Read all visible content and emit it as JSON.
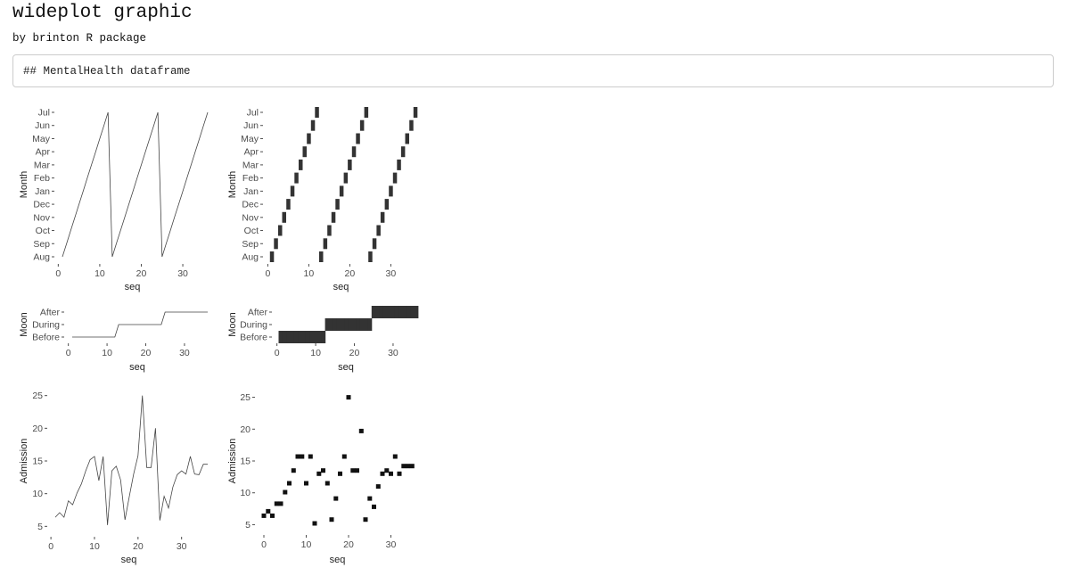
{
  "page": {
    "title": "wideplot graphic",
    "subtitle": "by brinton R package",
    "code_text": "## MentalHealth dataframe"
  },
  "colors": {
    "line": "#444444",
    "ribbon": "#333333",
    "point": "#111111",
    "tick": "#4d4d4d",
    "text": "#222222"
  },
  "chart_data": [
    {
      "id": "month-line",
      "type": "line",
      "xlabel": "seq",
      "ylabel": "Month",
      "xticks": [
        0,
        10,
        20,
        30
      ],
      "xlim": [
        1,
        36
      ],
      "y_categories": [
        "Aug",
        "Sep",
        "Oct",
        "Nov",
        "Dec",
        "Jan",
        "Feb",
        "Mar",
        "Apr",
        "May",
        "Jun",
        "Jul"
      ],
      "x": [
        1,
        2,
        3,
        4,
        5,
        6,
        7,
        8,
        9,
        10,
        11,
        12,
        13,
        14,
        15,
        16,
        17,
        18,
        19,
        20,
        21,
        22,
        23,
        24,
        25,
        26,
        27,
        28,
        29,
        30,
        31,
        32,
        33,
        34,
        35,
        36
      ],
      "y": [
        "Aug",
        "Sep",
        "Oct",
        "Nov",
        "Dec",
        "Jan",
        "Feb",
        "Mar",
        "Apr",
        "May",
        "Jun",
        "Jul",
        "Aug",
        "Sep",
        "Oct",
        "Nov",
        "Dec",
        "Jan",
        "Feb",
        "Mar",
        "Apr",
        "May",
        "Jun",
        "Jul",
        "Aug",
        "Sep",
        "Oct",
        "Nov",
        "Dec",
        "Jan",
        "Feb",
        "Mar",
        "Apr",
        "May",
        "Jun",
        "Jul"
      ]
    },
    {
      "id": "month-tiles",
      "type": "heatmap",
      "xlabel": "seq",
      "ylabel": "Month",
      "xticks": [
        0,
        10,
        20,
        30
      ],
      "xlim": [
        1,
        36
      ],
      "y_categories": [
        "Aug",
        "Sep",
        "Oct",
        "Nov",
        "Dec",
        "Jan",
        "Feb",
        "Mar",
        "Apr",
        "May",
        "Jun",
        "Jul"
      ],
      "x": [
        1,
        2,
        3,
        4,
        5,
        6,
        7,
        8,
        9,
        10,
        11,
        12,
        13,
        14,
        15,
        16,
        17,
        18,
        19,
        20,
        21,
        22,
        23,
        24,
        25,
        26,
        27,
        28,
        29,
        30,
        31,
        32,
        33,
        34,
        35,
        36
      ],
      "y": [
        "Aug",
        "Sep",
        "Oct",
        "Nov",
        "Dec",
        "Jan",
        "Feb",
        "Mar",
        "Apr",
        "May",
        "Jun",
        "Jul",
        "Aug",
        "Sep",
        "Oct",
        "Nov",
        "Dec",
        "Jan",
        "Feb",
        "Mar",
        "Apr",
        "May",
        "Jun",
        "Jul",
        "Aug",
        "Sep",
        "Oct",
        "Nov",
        "Dec",
        "Jan",
        "Feb",
        "Mar",
        "Apr",
        "May",
        "Jun",
        "Jul"
      ]
    },
    {
      "id": "moon-line",
      "type": "line",
      "xlabel": "seq",
      "ylabel": "Moon",
      "xticks": [
        0,
        10,
        20,
        30
      ],
      "xlim": [
        1,
        36
      ],
      "y_categories": [
        "Before",
        "During",
        "After"
      ],
      "x": [
        1,
        2,
        3,
        4,
        5,
        6,
        7,
        8,
        9,
        10,
        11,
        12,
        13,
        14,
        15,
        16,
        17,
        18,
        19,
        20,
        21,
        22,
        23,
        24,
        25,
        26,
        27,
        28,
        29,
        30,
        31,
        32,
        33,
        34,
        35,
        36
      ],
      "y": [
        "Before",
        "Before",
        "Before",
        "Before",
        "Before",
        "Before",
        "Before",
        "Before",
        "Before",
        "Before",
        "Before",
        "Before",
        "During",
        "During",
        "During",
        "During",
        "During",
        "During",
        "During",
        "During",
        "During",
        "During",
        "During",
        "During",
        "After",
        "After",
        "After",
        "After",
        "After",
        "After",
        "After",
        "After",
        "After",
        "After",
        "After",
        "After"
      ]
    },
    {
      "id": "moon-tiles",
      "type": "heatmap",
      "xlabel": "seq",
      "ylabel": "Moon",
      "xticks": [
        0,
        10,
        20,
        30
      ],
      "xlim": [
        1,
        36
      ],
      "y_categories": [
        "Before",
        "During",
        "After"
      ],
      "x": [
        1,
        2,
        3,
        4,
        5,
        6,
        7,
        8,
        9,
        10,
        11,
        12,
        13,
        14,
        15,
        16,
        17,
        18,
        19,
        20,
        21,
        22,
        23,
        24,
        25,
        26,
        27,
        28,
        29,
        30,
        31,
        32,
        33,
        34,
        35,
        36
      ],
      "y": [
        "Before",
        "Before",
        "Before",
        "Before",
        "Before",
        "Before",
        "Before",
        "Before",
        "Before",
        "Before",
        "Before",
        "Before",
        "During",
        "During",
        "During",
        "During",
        "During",
        "During",
        "During",
        "During",
        "During",
        "During",
        "During",
        "During",
        "After",
        "After",
        "After",
        "After",
        "After",
        "After",
        "After",
        "After",
        "After",
        "After",
        "After",
        "After"
      ]
    },
    {
      "id": "admission-line",
      "type": "line",
      "xlabel": "seq",
      "ylabel": "Admission",
      "xticks": [
        0,
        10,
        20,
        30
      ],
      "yticks": [
        5,
        10,
        15,
        20,
        25
      ],
      "xlim": [
        1,
        36
      ],
      "ylim": [
        4.5,
        25.5
      ],
      "x": [
        1,
        2,
        3,
        4,
        5,
        6,
        7,
        8,
        9,
        10,
        11,
        12,
        13,
        14,
        15,
        16,
        17,
        18,
        19,
        20,
        21,
        22,
        23,
        24,
        25,
        26,
        27,
        28,
        29,
        30,
        31,
        32,
        33,
        34,
        35,
        36
      ],
      "y": [
        6.4,
        7.1,
        6.4,
        8.9,
        8.3,
        10.1,
        11.5,
        13.5,
        15.2,
        15.7,
        12.0,
        15.7,
        5.2,
        13.5,
        14.2,
        12.1,
        6.0,
        9.6,
        13.0,
        15.8,
        25.0,
        14.0,
        14.0,
        20.0,
        5.9,
        9.6,
        7.8,
        11.0,
        12.9,
        13.5,
        13.0,
        15.7,
        13.0,
        12.9,
        14.5,
        14.5
      ]
    },
    {
      "id": "admission-points",
      "type": "scatter",
      "xlabel": "seq",
      "ylabel": "Admission",
      "xticks": [
        0,
        10,
        20,
        30
      ],
      "yticks": [
        5,
        10,
        15,
        20,
        25
      ],
      "xlim": [
        0,
        36
      ],
      "ylim": [
        4.5,
        25.5
      ],
      "x": [
        0,
        1,
        2,
        3,
        4,
        5,
        6,
        7,
        8,
        9,
        10,
        11,
        12,
        13,
        14,
        15,
        16,
        17,
        18,
        19,
        20,
        21,
        22,
        23,
        24,
        25,
        26,
        27,
        28,
        29,
        30,
        31,
        32,
        33,
        34,
        35
      ],
      "y": [
        6.4,
        7.1,
        6.4,
        8.3,
        8.3,
        10.1,
        11.5,
        13.5,
        15.7,
        15.7,
        11.5,
        15.7,
        5.2,
        13.0,
        13.5,
        11.5,
        5.8,
        9.1,
        13.0,
        15.7,
        25.0,
        13.5,
        13.5,
        19.7,
        5.8,
        9.1,
        7.8,
        11.0,
        13.0,
        13.5,
        13.0,
        15.7,
        13.0,
        14.2,
        14.2,
        14.2
      ]
    }
  ]
}
